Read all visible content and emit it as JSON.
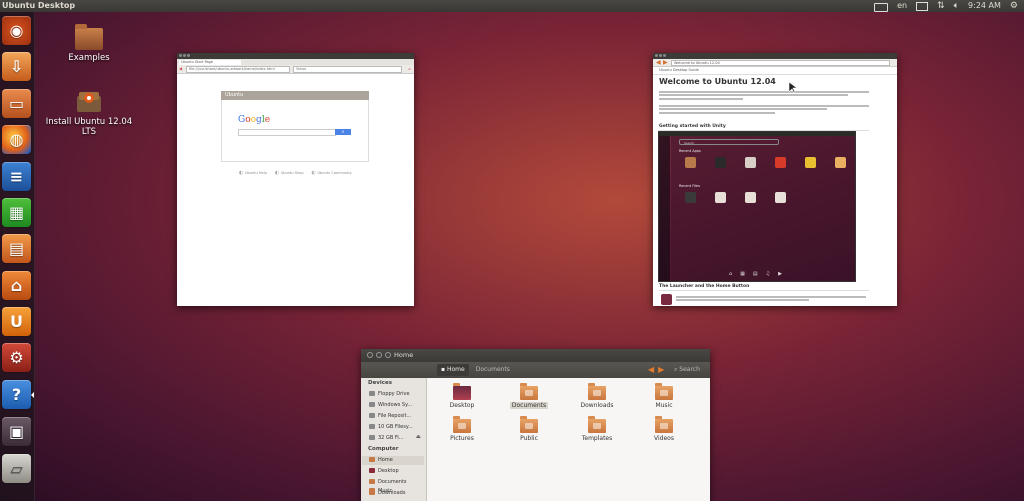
{
  "top_panel": {
    "title": "Ubuntu Desktop",
    "lang": "en",
    "time": "9:24 AM"
  },
  "launcher": {
    "items": [
      {
        "name": "Dash home",
        "glyph": "◉"
      },
      {
        "name": "Installer",
        "glyph": "⇩"
      },
      {
        "name": "Files",
        "glyph": "▭"
      },
      {
        "name": "Firefox",
        "glyph": "◍"
      },
      {
        "name": "LibreOffice Writer",
        "glyph": "≡"
      },
      {
        "name": "LibreOffice Calc",
        "glyph": "▦"
      },
      {
        "name": "LibreOffice Impress",
        "glyph": "▤"
      },
      {
        "name": "Ubuntu Software Centre",
        "glyph": "⌂"
      },
      {
        "name": "Ubuntu One",
        "glyph": "U"
      },
      {
        "name": "System Settings",
        "glyph": "⚙"
      },
      {
        "name": "Help",
        "glyph": "?"
      },
      {
        "name": "Workspace Switcher",
        "glyph": "▣"
      },
      {
        "name": "Trash",
        "glyph": "▱"
      }
    ]
  },
  "desktop": {
    "icons": [
      {
        "label": "Examples"
      },
      {
        "label": "Install Ubuntu 12.04 LTS"
      }
    ]
  },
  "firefox_window": {
    "tab_label": "Ubuntu Start Page",
    "url": "file:///usr/share/ubuntu-artwork/home/index.html",
    "search_placeholder": "Yahoo",
    "header": "Ubuntu",
    "google_logo": "Google",
    "search_button": "",
    "bookmarks": [
      "Ubuntu Help",
      "Ubuntu Shop",
      "Ubuntu Community"
    ]
  },
  "help_window": {
    "address": "Welcome to Ubuntu 12.04",
    "crumb": "Ubuntu Desktop Guide",
    "title": "Welcome to Ubuntu 12.04",
    "section1": "Getting started with Unity",
    "section2": "The Launcher and the Home Button",
    "dash": {
      "search_placeholder": "Search",
      "recent_apps": "Recent Apps",
      "recent_files": "Recent Files"
    }
  },
  "files_window": {
    "title": "Home",
    "path": {
      "home": "Home",
      "next": "Documents"
    },
    "search_label": "Search",
    "sidebar": {
      "devices_header": "Devices",
      "devices": [
        "Floppy Drive",
        "Windows Sy...",
        "File Reposit...",
        "10 GB Filesy...",
        "32 GB Fi..."
      ],
      "computer_header": "Computer",
      "places": [
        "Home",
        "Desktop",
        "Documents",
        "Downloads",
        "Music"
      ]
    },
    "folders": [
      "Desktop",
      "Documents",
      "Downloads",
      "Music",
      "Pictures",
      "Public",
      "Templates",
      "Videos"
    ]
  },
  "colors": {
    "launcher_bg": "#1e141c",
    "accent": "#dd4814",
    "panel": "#3c3b37"
  }
}
